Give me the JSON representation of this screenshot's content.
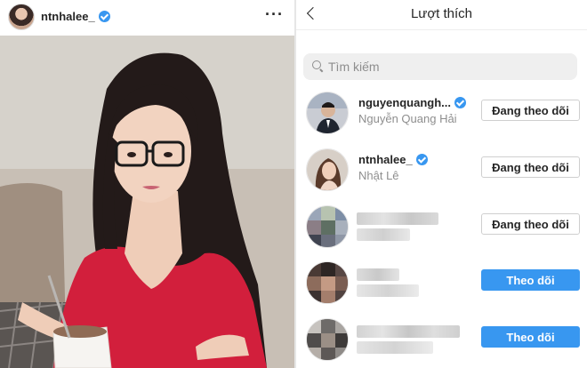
{
  "post": {
    "username": "ntnhalee_",
    "more_icon": "more-horizontal-icon",
    "verified": true
  },
  "likes_panel": {
    "title": "Lượt thích",
    "back_icon": "chevron-left-icon",
    "search": {
      "placeholder": "Tìm kiếm",
      "value": ""
    },
    "users": [
      {
        "username": "nguyenquangh...",
        "full_name": "Nguyễn Quang Hải",
        "verified": true,
        "button": "Đang theo dõi",
        "state": "following"
      },
      {
        "username": "ntnhalee_",
        "full_name": "Nhật Lê",
        "verified": true,
        "button": "Đang theo dõi",
        "state": "following"
      },
      {
        "username": "",
        "full_name": "",
        "verified": false,
        "button": "Đang theo dõi",
        "state": "following",
        "obscured": true
      },
      {
        "username": "",
        "full_name": "",
        "verified": false,
        "button": "Theo dõi",
        "state": "follow",
        "obscured": true
      },
      {
        "username": "",
        "full_name": "",
        "verified": false,
        "button": "Theo dõi",
        "state": "follow",
        "obscured": true
      }
    ]
  },
  "colors": {
    "accent": "#3897f0",
    "text": "#262626",
    "muted": "#8e8e8e",
    "search_bg": "#efefef"
  }
}
